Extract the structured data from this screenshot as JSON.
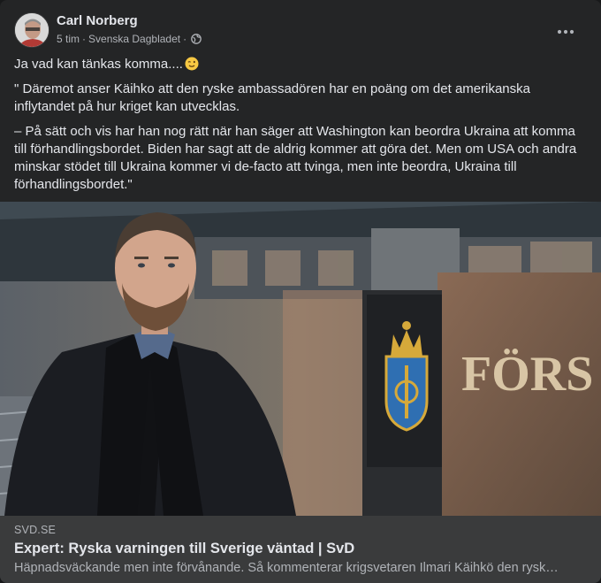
{
  "post": {
    "author": "Carl Norberg",
    "time": "5 tim",
    "separator": "·",
    "group": "Svenska Dagbladet",
    "separator2": "·",
    "audience_icon": "globe-icon",
    "more_icon": "more-horizontal-icon",
    "paragraphs": [
      "Ja vad kan tänkas komma....",
      "\" Däremot anser Käihko att den ryske ambassadören har en poäng om det amerikanska inflytandet på hur kriget kan utvecklas.",
      "– På sätt och vis har han nog rätt när han säger att Washington kan beordra Ukraina att komma till förhandlingsbordet. Biden har sagt att de aldrig kommer att göra det. Men om USA och andra minskar stödet till Ukraina kommer vi de-facto att tvinga, men inte beordra, Ukraina till förhandlingsbordet.\""
    ],
    "emoji": "wink-emoji"
  },
  "link": {
    "domain": "SVD.SE",
    "headline": "Expert: Ryska varningen till Sverige väntad | SvD",
    "description": "Häpnadsväckande men inte förvånande. Så kommenterar krigsvetaren Ilmari Käihkö den rysk…",
    "sign_text": "FÖRS"
  },
  "colors": {
    "card_bg": "#242526",
    "text_primary": "#e4e6eb",
    "text_secondary": "#b0b3b8",
    "link_bg": "#3a3b3c"
  }
}
